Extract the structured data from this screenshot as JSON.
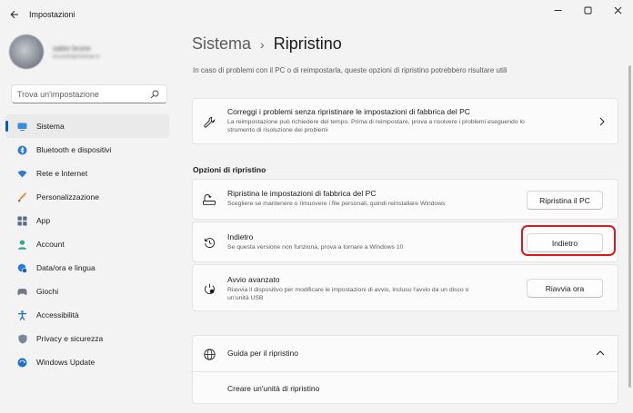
{
  "window": {
    "title": "Impostazioni",
    "controls": [
      "minimize-icon",
      "maximize-icon",
      "close-icon"
    ]
  },
  "profile": {
    "name": "sabio brune",
    "email": "brusell9@hotmail.it"
  },
  "search": {
    "placeholder": "Trova un'impostazione"
  },
  "sidebar": {
    "items": [
      {
        "label": "Sistema",
        "icon": "monitor-icon",
        "active": true
      },
      {
        "label": "Bluetooth e dispositivi",
        "icon": "bluetooth-icon"
      },
      {
        "label": "Rete e Internet",
        "icon": "wifi-icon"
      },
      {
        "label": "Personalizzazione",
        "icon": "brush-icon"
      },
      {
        "label": "App",
        "icon": "apps-icon"
      },
      {
        "label": "Account",
        "icon": "person-icon"
      },
      {
        "label": "Data/ora e lingua",
        "icon": "globe-clock-icon"
      },
      {
        "label": "Giochi",
        "icon": "gamepad-icon"
      },
      {
        "label": "Accessibilità",
        "icon": "accessibility-icon"
      },
      {
        "label": "Privacy e sicurezza",
        "icon": "shield-icon"
      },
      {
        "label": "Windows Update",
        "icon": "update-icon"
      }
    ]
  },
  "header": {
    "parent": "Sistema",
    "separator": "›",
    "current": "Ripristino",
    "subtitle": "In caso di problemi con il PC o di reimpostarla, queste opzioni di ripristino potrebbero risultare utili"
  },
  "fix_card": {
    "title": "Correggi i problemi senza ripristinare le impostazioni di fabbrica del PC",
    "desc_line1": "La reimpostazione può richiedere del tempo. Prima di reimpostare, prova a risolvere i problemi eseguendo lo",
    "desc_line2": "strumento di risoluzione dei problemi"
  },
  "options": {
    "section_title": "Opzioni di ripristino",
    "reset": {
      "title": "Ripristina le impostazioni di fabbrica del PC",
      "desc": "Scegliere se mantenere o rimuovere i file personali, quindi reinstallare Windows",
      "button": "Ripristina il PC"
    },
    "goback": {
      "title": "Indietro",
      "desc": "Se questa versione non funziona, prova a tornare a Windows 10",
      "button": "Indietro"
    },
    "advanced": {
      "title": "Avvio avanzato",
      "desc_line1": "Riavvia il dispositivo per modificare le impostazioni di avvio, incluso l'avvio da un disco o",
      "desc_line2": "un'unità USB",
      "button": "Riavvia ora"
    }
  },
  "help": {
    "title": "Guida per il ripristino",
    "link": "Creare un'unità di ripristino"
  },
  "colors": {
    "accent": "#005fb8",
    "highlight": "#e0161b"
  }
}
